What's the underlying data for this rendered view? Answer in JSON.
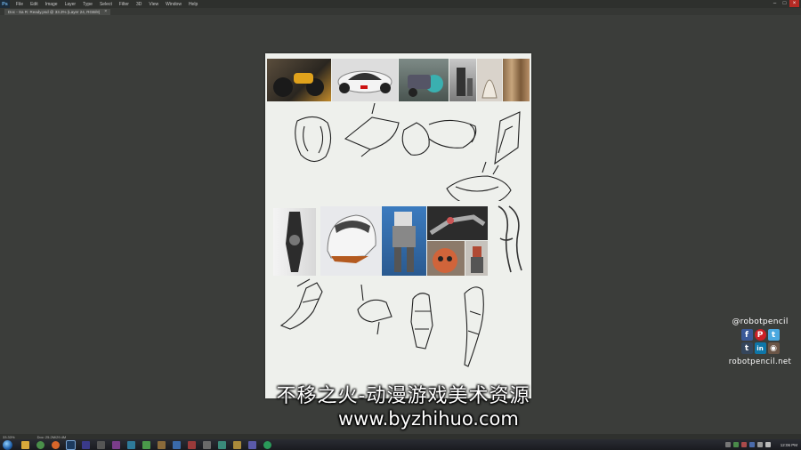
{
  "app": {
    "logo": "Ps",
    "menus": [
      "File",
      "Edit",
      "Image",
      "Layer",
      "Type",
      "Select",
      "Filter",
      "3D",
      "View",
      "Window",
      "Help"
    ],
    "window_controls": [
      "minimize-icon",
      "maximize-icon",
      "close-icon"
    ]
  },
  "document": {
    "tab_label": "Doc - Sa R: Ready.psd @ 33.3% (Layer 24, RGB/8)",
    "tab_close": "×"
  },
  "status": {
    "zoom": "33.33%",
    "doc_size": "Doc: 25.2M/29.4M"
  },
  "watermark": {
    "chinese": "不移之火-动漫游戏美术资源",
    "url": "www.byzhihuo.com"
  },
  "brand": {
    "handle": "@robotpencil",
    "site": "robotpencil.net",
    "social": [
      {
        "icon": "facebook-icon",
        "glyph": "f",
        "color": "#3b5998"
      },
      {
        "icon": "pinterest-icon",
        "glyph": "P",
        "color": "#cb2027"
      },
      {
        "icon": "twitter-icon",
        "glyph": "t",
        "color": "#4aa8e0"
      },
      {
        "icon": "tumblr-icon",
        "glyph": "t",
        "color": "#35465c"
      },
      {
        "icon": "linkedin-icon",
        "glyph": "in",
        "color": "#0e76a8"
      },
      {
        "icon": "instagram-icon",
        "glyph": "◉",
        "color": "#6b5546"
      }
    ]
  },
  "taskbar": {
    "clock": "12:06 PM",
    "icons": [
      "explorer-icon",
      "chrome-icon",
      "firefox-icon",
      "photoshop-icon",
      "media-icon",
      "app-icon",
      "app-icon",
      "app-icon",
      "app-icon",
      "app-icon",
      "app-icon",
      "app-icon",
      "app-icon",
      "app-icon",
      "app-icon",
      "app-icon",
      "app-icon"
    ]
  }
}
